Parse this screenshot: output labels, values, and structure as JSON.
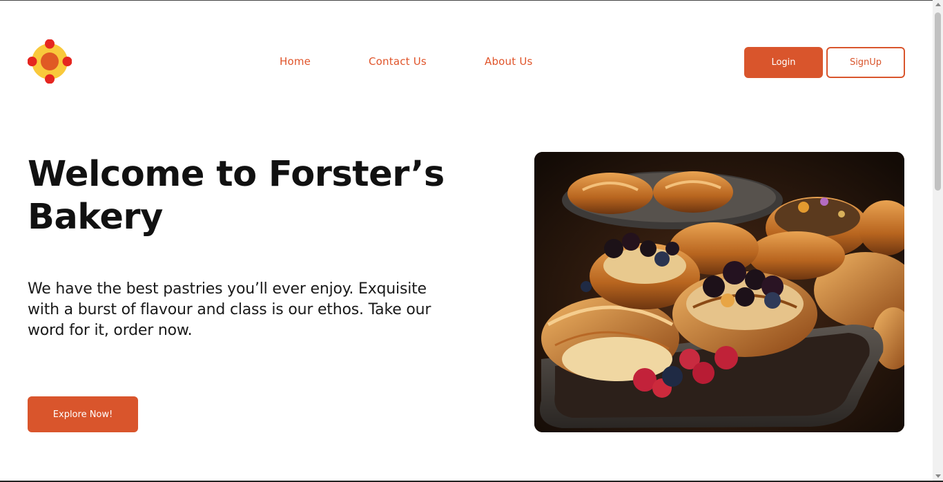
{
  "brand": {
    "logo_icon": "bakery-flower-logo-icon",
    "accent": "#d9552c",
    "logo_yellow": "#f9c93c",
    "logo_red": "#e52620"
  },
  "nav": {
    "links": [
      {
        "label": "Home"
      },
      {
        "label": "Contact Us"
      },
      {
        "label": "About Us"
      }
    ]
  },
  "auth": {
    "login_label": "Login",
    "signup_label": "SignUp"
  },
  "hero": {
    "title": "Welcome to Forster’s Bakery",
    "description": "We have the best pastries you’ll ever enjoy. Exquisite with a burst of flavour and class is our ethos. Take our word for it, order now.",
    "cta_label": "Explore Now!",
    "image_icon": "pastries-photo"
  }
}
